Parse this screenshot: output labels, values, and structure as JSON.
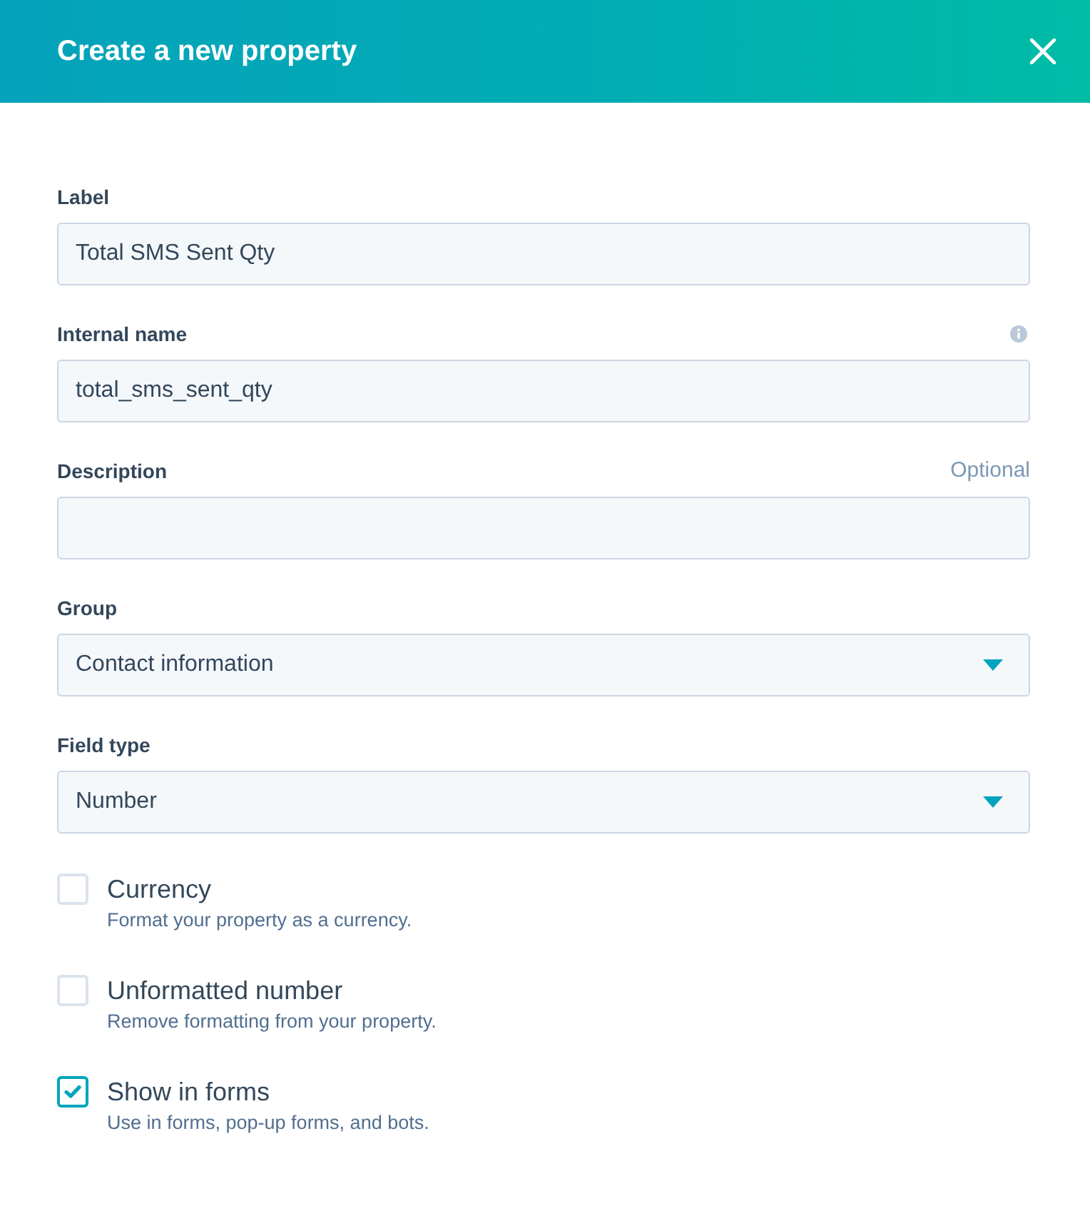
{
  "dialog": {
    "title": "Create a new property"
  },
  "fields": [
    {
      "kind": "text",
      "label": "Label",
      "value": "Total SMS Sent Qty"
    },
    {
      "kind": "text",
      "label": "Internal name",
      "value": "total_sms_sent_qty",
      "info": true
    },
    {
      "kind": "text",
      "label": "Description",
      "hint": "Optional"
    },
    {
      "kind": "select",
      "label": "Group",
      "value": "Contact information"
    },
    {
      "kind": "select",
      "label": "Field type",
      "value": "Number"
    }
  ],
  "options": [
    {
      "label": "Currency",
      "description": "Format your property as a currency.",
      "checked": false
    },
    {
      "label": "Unformatted number",
      "description": "Remove formatting from your property.",
      "checked": false
    },
    {
      "label": "Show in forms",
      "description": "Use in forms, pop-up forms, and bots.",
      "checked": true
    }
  ]
}
